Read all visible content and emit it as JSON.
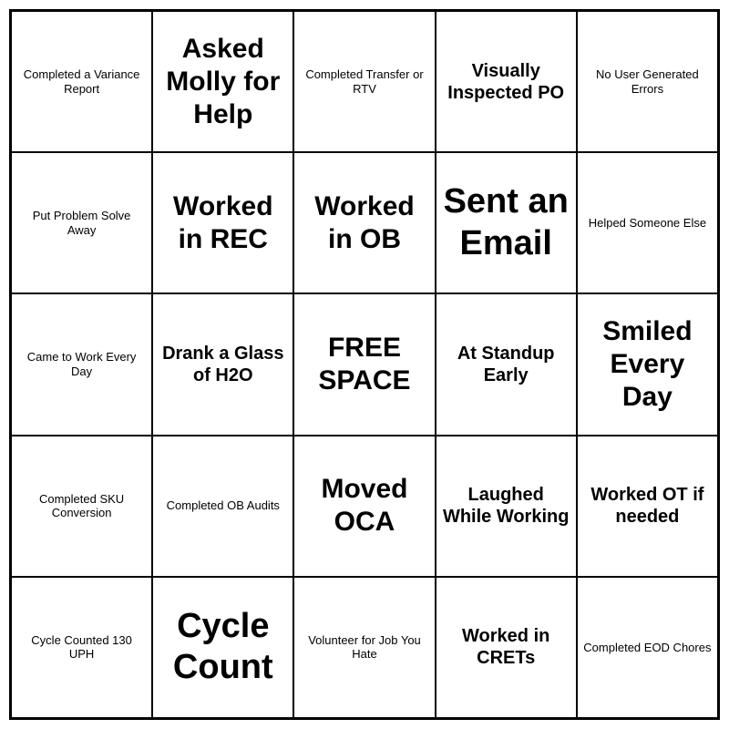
{
  "grid": {
    "cells": [
      {
        "id": "r0c0",
        "text": "Completed a Variance Report",
        "size": "small"
      },
      {
        "id": "r0c1",
        "text": "Asked Molly for Help",
        "size": "large"
      },
      {
        "id": "r0c2",
        "text": "Completed Transfer or RTV",
        "size": "small"
      },
      {
        "id": "r0c3",
        "text": "Visually Inspected PO",
        "size": "medium"
      },
      {
        "id": "r0c4",
        "text": "No User Generated Errors",
        "size": "small"
      },
      {
        "id": "r1c0",
        "text": "Put Problem Solve Away",
        "size": "small"
      },
      {
        "id": "r1c1",
        "text": "Worked in REC",
        "size": "large"
      },
      {
        "id": "r1c2",
        "text": "Worked in OB",
        "size": "large"
      },
      {
        "id": "r1c3",
        "text": "Sent an Email",
        "size": "xlarge"
      },
      {
        "id": "r1c4",
        "text": "Helped Someone Else",
        "size": "small"
      },
      {
        "id": "r2c0",
        "text": "Came to Work Every Day",
        "size": "small"
      },
      {
        "id": "r2c1",
        "text": "Drank a Glass of H2O",
        "size": "medium"
      },
      {
        "id": "r2c2",
        "text": "FREE SPACE",
        "size": "large"
      },
      {
        "id": "r2c3",
        "text": "At Standup Early",
        "size": "medium"
      },
      {
        "id": "r2c4",
        "text": "Smiled Every Day",
        "size": "large"
      },
      {
        "id": "r3c0",
        "text": "Completed SKU Conversion",
        "size": "small"
      },
      {
        "id": "r3c1",
        "text": "Completed OB Audits",
        "size": "small"
      },
      {
        "id": "r3c2",
        "text": "Moved OCA",
        "size": "large"
      },
      {
        "id": "r3c3",
        "text": "Laughed While Working",
        "size": "medium"
      },
      {
        "id": "r3c4",
        "text": "Worked OT if needed",
        "size": "medium"
      },
      {
        "id": "r4c0",
        "text": "Cycle Counted 130 UPH",
        "size": "small"
      },
      {
        "id": "r4c1",
        "text": "Cycle Count",
        "size": "xlarge"
      },
      {
        "id": "r4c2",
        "text": "Volunteer for Job You Hate",
        "size": "small"
      },
      {
        "id": "r4c3",
        "text": "Worked in CRETs",
        "size": "medium"
      },
      {
        "id": "r4c4",
        "text": "Completed EOD Chores",
        "size": "small"
      }
    ]
  }
}
